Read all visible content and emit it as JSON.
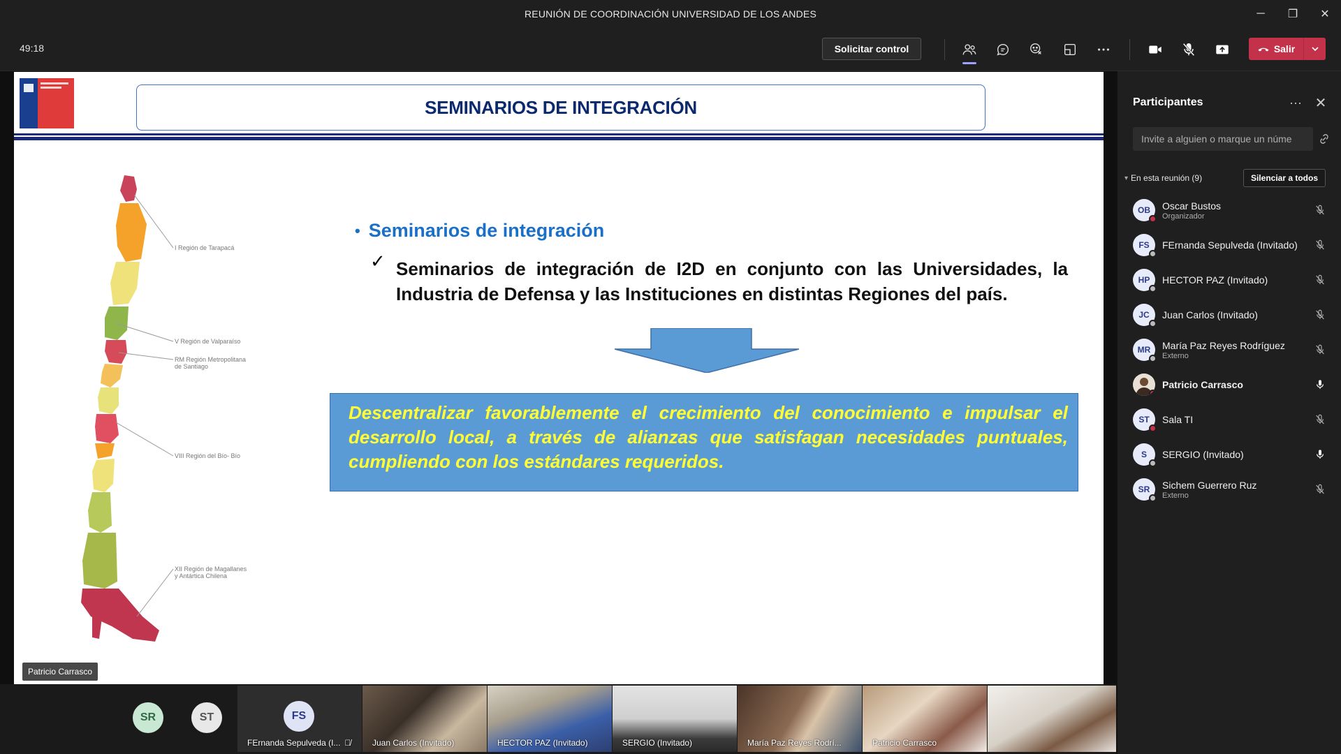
{
  "window": {
    "title": "REUNIÓN DE COORDINACIÓN UNIVERSIDAD DE LOS ANDES",
    "minimize": "─",
    "restore": "❐",
    "close": "✕"
  },
  "toolbar": {
    "timer": "49:18",
    "request_control": "Solicitar control",
    "leave": "Salir",
    "leave_color": "#c4314b",
    "icons": [
      "people-icon",
      "chat-icon",
      "reactions-icon",
      "rooms-icon",
      "more-icon",
      "camera-icon",
      "mic-off-icon",
      "share-icon"
    ]
  },
  "slide": {
    "title": "SEMINARIOS DE INTEGRACIÓN",
    "bullet": "Seminarios de integración",
    "check_mark": "✓",
    "sub_point": "Seminarios de integración de I2D en conjunto con las Universidades, la Industria de Defensa y las Instituciones en distintas Regiones del país.",
    "callout": "Descentralizar favorablemente el crecimiento del conocimiento e impulsar el desarrollo local, a través de alianzas que satisfagan  necesidades puntuales, cumpliendo con los estándares requeridos.",
    "map_labels": [
      "I Región de Tarapacá",
      "V Región de Valparaíso",
      "RM Región Metropolitana",
      "de Santiago",
      "VIII Región del Bío- Bío",
      "XII Región de Magallanes",
      "y Antártica Chilena"
    ],
    "logo_text": [
      "Subsecretaría",
      "de Defensa",
      "Gobierno de Chile"
    ],
    "presenter": "Patricio Carrasco"
  },
  "panel": {
    "title": "Participantes",
    "more": "···",
    "close": "✕",
    "invite_placeholder": "Invite a alguien o marque un núme",
    "section_label": "En esta reunión (9)",
    "mute_all": "Silenciar a todos",
    "participants": [
      {
        "initials": "OB",
        "name": "Oscar Bustos",
        "role": "Organizador",
        "mic": "off",
        "status": "red"
      },
      {
        "initials": "FS",
        "name": "FErnanda Sepulveda (Invitado)",
        "role": "",
        "mic": "off",
        "status": "grey"
      },
      {
        "initials": "HP",
        "name": "HECTOR PAZ (Invitado)",
        "role": "",
        "mic": "off",
        "status": "grey"
      },
      {
        "initials": "JC",
        "name": "Juan Carlos (Invitado)",
        "role": "",
        "mic": "off",
        "status": "grey"
      },
      {
        "initials": "MR",
        "name": "María Paz Reyes Rodríguez",
        "role": "Externo",
        "mic": "off",
        "status": "grey"
      },
      {
        "initials": "",
        "name": "Patricio Carrasco",
        "role": "",
        "mic": "on",
        "status": "red"
      },
      {
        "initials": "ST",
        "name": "Sala TI",
        "role": "",
        "mic": "off",
        "status": "red"
      },
      {
        "initials": "S",
        "name": "SERGIO (Invitado)",
        "role": "",
        "mic": "on",
        "status": "grey"
      },
      {
        "initials": "SR",
        "name": "Sichem Guerrero Ruz",
        "role": "Externo",
        "mic": "off",
        "status": "grey"
      }
    ]
  },
  "gallery": {
    "bubbles": [
      {
        "initials": "SR"
      },
      {
        "initials": "ST"
      }
    ],
    "tiles": [
      {
        "initials": "FS",
        "label": "FErnanda Sepulveda (I..."
      },
      {
        "label": "Juan Carlos (Invitado)"
      },
      {
        "label": "HECTOR PAZ (Invitado)"
      },
      {
        "label": "SERGIO (Invitado)"
      },
      {
        "label": "María Paz Reyes Rodrí..."
      },
      {
        "label": "Patricio Carrasco"
      },
      {
        "label": ""
      }
    ]
  }
}
